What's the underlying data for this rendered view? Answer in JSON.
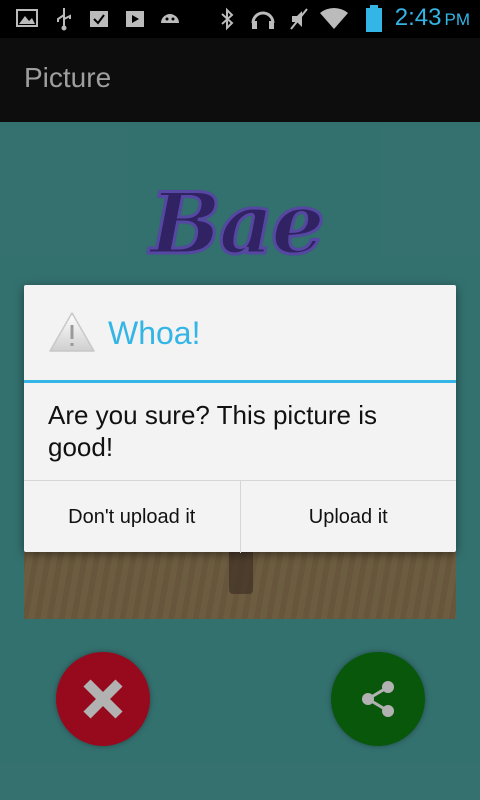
{
  "status_bar": {
    "time": "2:43",
    "ampm": "PM",
    "icons": [
      "image-icon",
      "usb-icon",
      "clipboard-check-icon",
      "media-icon",
      "android-icon",
      "bluetooth-icon",
      "headset-icon",
      "mute-icon",
      "wifi-icon",
      "battery-icon"
    ]
  },
  "action_bar": {
    "title": "Picture"
  },
  "content": {
    "logo_text": "Bae",
    "cancel_button_icon": "close-icon",
    "share_button_icon": "share-icon"
  },
  "dialog": {
    "title": "Whoa!",
    "message": "Are you sure? This picture is good!",
    "negative_label": "Don't upload it",
    "positive_label": "Upload it",
    "accent_color": "#33b5e5"
  }
}
